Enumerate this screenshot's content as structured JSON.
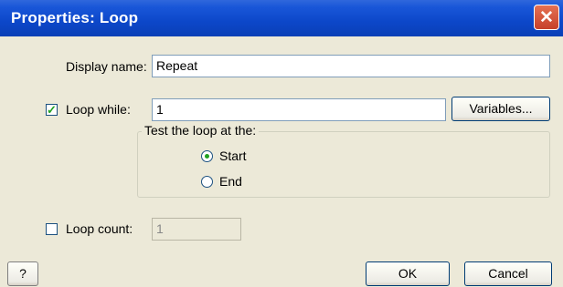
{
  "window": {
    "title": "Properties: Loop",
    "close_glyph": "✕"
  },
  "display_name": {
    "label": "Display name:",
    "value": "Repeat"
  },
  "loop_while": {
    "checked": true,
    "check_glyph": "✓",
    "label": "Loop while:",
    "value": "1",
    "variables_button": "Variables..."
  },
  "test_group": {
    "legend": "Test the loop at the:",
    "options": [
      {
        "label": "Start",
        "selected": true
      },
      {
        "label": "End",
        "selected": false
      }
    ]
  },
  "loop_count": {
    "checked": false,
    "label": "Loop count:",
    "value": "1"
  },
  "buttons": {
    "help": "?",
    "ok": "OK",
    "cancel": "Cancel"
  },
  "colors": {
    "titlebar": "#0c47c9",
    "dialog_bg": "#ece9d8",
    "close_button": "#d0513a",
    "check_accent": "#21a121"
  }
}
